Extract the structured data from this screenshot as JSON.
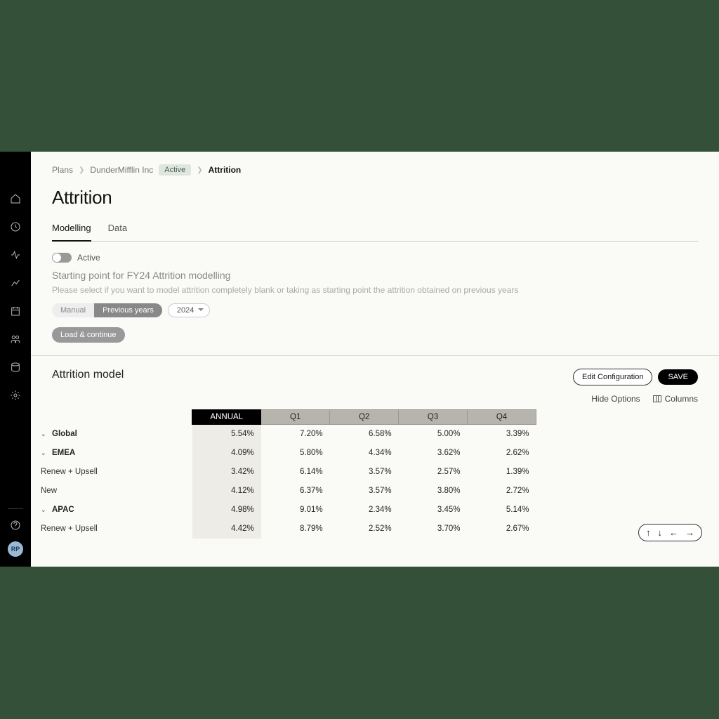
{
  "breadcrumbs": {
    "item1": "Plans",
    "item2": "DunderMifflin Inc",
    "badge": "Active",
    "current": "Attrition"
  },
  "page_title": "Attrition",
  "tabs": {
    "modelling": "Modelling",
    "data": "Data"
  },
  "toggle_label": "Active",
  "section_heading": "Starting point for FY24 Attrition modelling",
  "section_desc": "Please select if you want to model attrition completely blank or taking as starting point the attrition obtained on previous years",
  "segments": {
    "manual": "Manual",
    "previous": "Previous years"
  },
  "year_value": "2024",
  "load_btn": "Load & continue",
  "model_title": "Attrition model",
  "buttons": {
    "edit": "Edit Configuration",
    "save": "SAVE"
  },
  "opts": {
    "hide": "Hide Options",
    "cols": "Columns"
  },
  "table": {
    "headers": {
      "annual": "ANNUAL",
      "q1": "Q1",
      "q2": "Q2",
      "q3": "Q3",
      "q4": "Q4"
    },
    "rows": [
      {
        "label": "Global",
        "level": 0,
        "expand": true,
        "annual": "5.54%",
        "q1": "7.20%",
        "q2": "6.58%",
        "q3": "5.00%",
        "q4": "3.39%"
      },
      {
        "label": "EMEA",
        "level": 1,
        "expand": true,
        "annual": "4.09%",
        "q1": "5.80%",
        "q2": "4.34%",
        "q3": "3.62%",
        "q4": "2.62%"
      },
      {
        "label": "Renew + Upsell",
        "level": 2,
        "expand": false,
        "annual": "3.42%",
        "q1": "6.14%",
        "q2": "3.57%",
        "q3": "2.57%",
        "q4": "1.39%"
      },
      {
        "label": "New",
        "level": 2,
        "expand": false,
        "annual": "4.12%",
        "q1": "6.37%",
        "q2": "3.57%",
        "q3": "3.80%",
        "q4": "2.72%"
      },
      {
        "label": "APAC",
        "level": 1,
        "expand": true,
        "annual": "4.98%",
        "q1": "9.01%",
        "q2": "2.34%",
        "q3": "3.45%",
        "q4": "5.14%"
      },
      {
        "label": "Renew + Upsell",
        "level": 2,
        "expand": false,
        "annual": "4.42%",
        "q1": "8.79%",
        "q2": "2.52%",
        "q3": "3.70%",
        "q4": "2.67%"
      }
    ]
  },
  "avatar_initials": "RP"
}
